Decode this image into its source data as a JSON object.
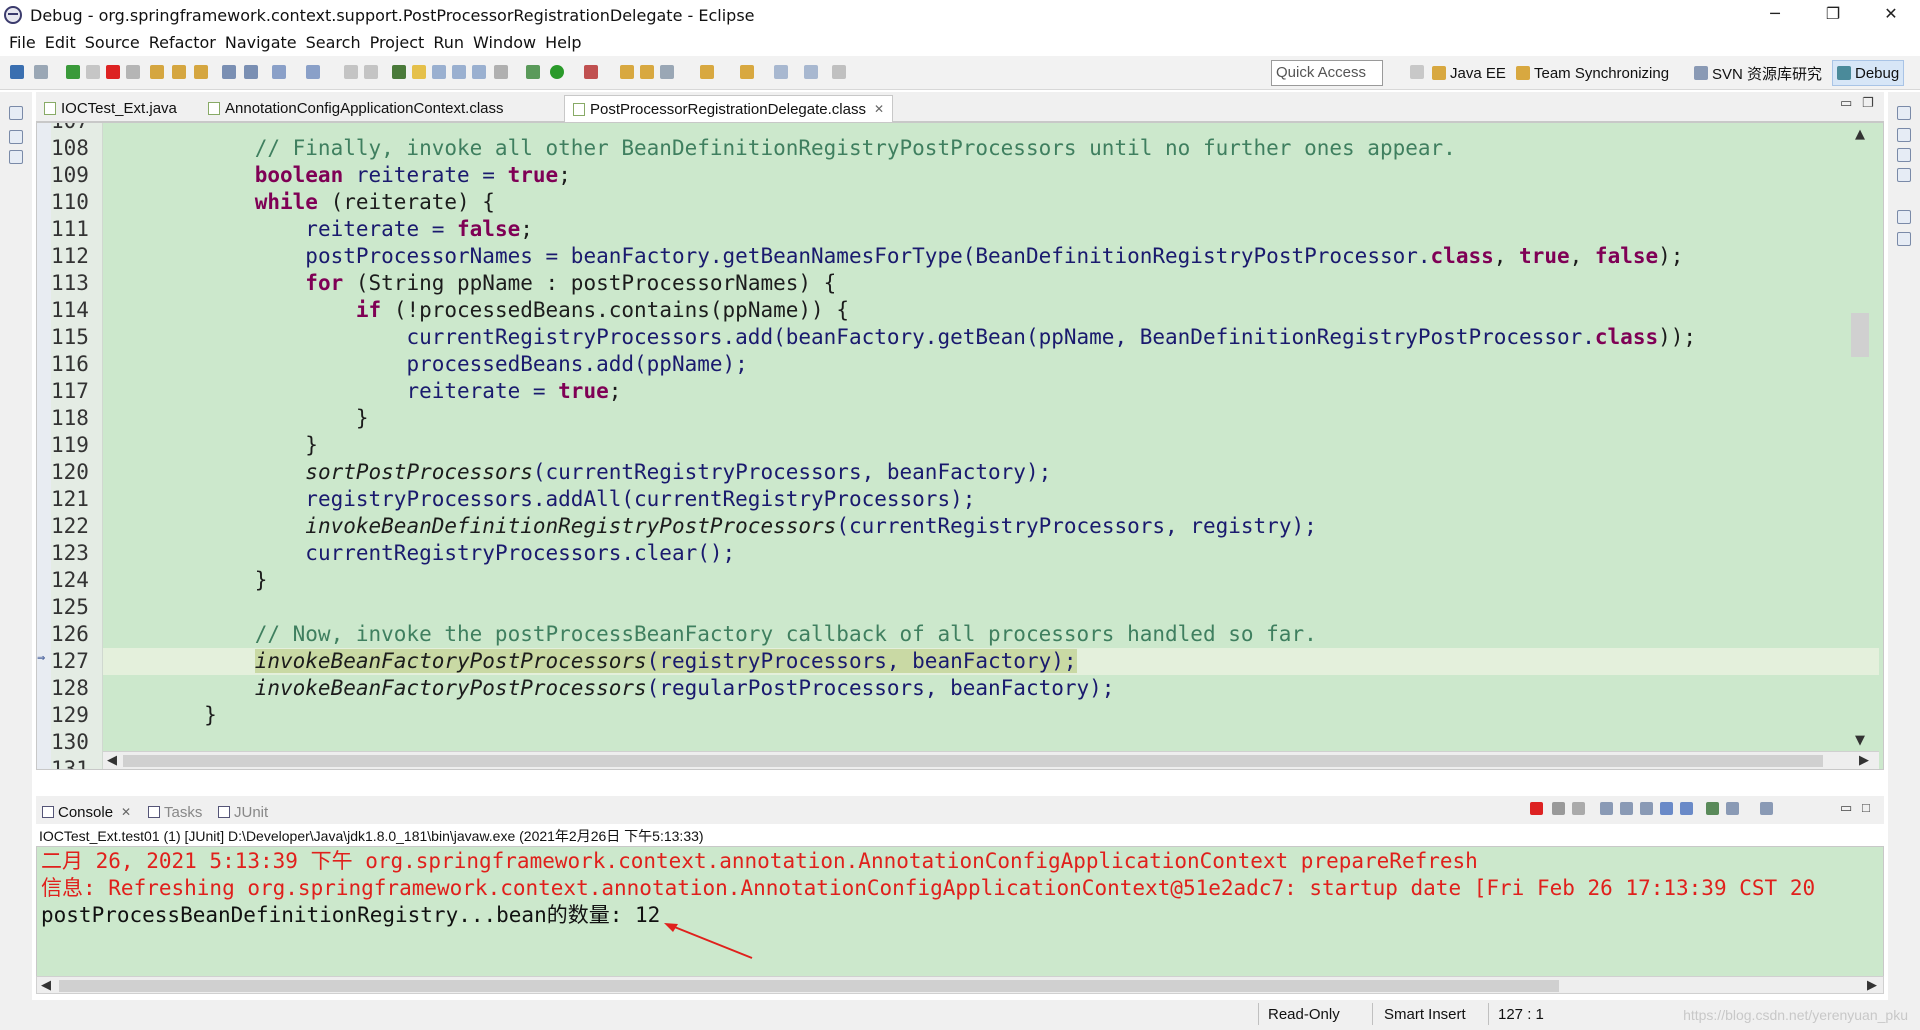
{
  "window": {
    "title": "Debug - org.springframework.context.support.PostProcessorRegistrationDelegate - Eclipse",
    "controls": [
      "─",
      "❐",
      "✕"
    ]
  },
  "menu": [
    "File",
    "Edit",
    "Source",
    "Refactor",
    "Navigate",
    "Search",
    "Project",
    "Run",
    "Window",
    "Help"
  ],
  "toolbar": {
    "quick_access_placeholder": "Quick Access",
    "perspectives": [
      "Java EE",
      "Team Synchronizing",
      "SVN 资源库研究",
      "Debug"
    ],
    "active_perspective": "Debug"
  },
  "editor": {
    "tabs": [
      {
        "label": "IOCTest_Ext.java",
        "active": false
      },
      {
        "label": "AnnotationConfigApplicationContext.class",
        "active": false
      },
      {
        "label": "PostProcessorRegistrationDelegate.class",
        "active": true
      }
    ],
    "partial_top_line": "107",
    "partial_bottom_line": "131",
    "line_numbers": [
      "108",
      "109",
      "110",
      "111",
      "112",
      "113",
      "114",
      "115",
      "116",
      "117",
      "118",
      "119",
      "120",
      "121",
      "122",
      "123",
      "124",
      "125",
      "126",
      "127",
      "128",
      "129",
      "130"
    ],
    "current_line": "127",
    "code": {
      "l108": "// Finally, invoke all other BeanDefinitionRegistryPostProcessors until no further ones appear.",
      "l109a": "boolean",
      "l109b": " reiterate = ",
      "l109c": "true",
      "l109d": ";",
      "l110a": "while",
      "l110b": " (reiterate) {",
      "l111a": "reiterate = ",
      "l111b": "false",
      "l111c": ";",
      "l112a": "postProcessorNames = beanFactory.getBeanNamesForType(BeanDefinitionRegistryPostProcessor.",
      "l112b": "class",
      "l112c": ", ",
      "l112d": "true",
      "l112e": ", ",
      "l112f": "false",
      "l112g": ");",
      "l113a": "for",
      "l113b": " (String ppName : postProcessorNames) {",
      "l114a": "if",
      "l114b": " (!processedBeans.contains(ppName)) {",
      "l115a": "currentRegistryProcessors.add(beanFactory.getBean(ppName, BeanDefinitionRegistryPostProcessor.",
      "l115b": "class",
      "l115c": "));",
      "l116": "processedBeans.add(ppName);",
      "l117a": "reiterate = ",
      "l117b": "true",
      "l117c": ";",
      "l118": "}",
      "l119": "}",
      "l120a": "sortPostProcessors",
      "l120b": "(currentRegistryProcessors, beanFactory);",
      "l121": "registryProcessors.addAll(currentRegistryProcessors);",
      "l122a": "invokeBeanDefinitionRegistryPostProcessors",
      "l122b": "(currentRegistryProcessors, registry);",
      "l123": "currentRegistryProcessors.clear();",
      "l124": "}",
      "l126": "// Now, invoke the postProcessBeanFactory callback of all processors handled so far.",
      "l127a": "invokeBeanFactoryPostProcessors",
      "l127b": "(registryProcessors, beanFactory);",
      "l128a": "invokeBeanFactoryPostProcessors",
      "l128b": "(regularPostProcessors, beanFactory);",
      "l129": "}"
    }
  },
  "console": {
    "tabs": [
      "Console",
      "Tasks",
      "JUnit"
    ],
    "launch": "IOCTest_Ext.test01 (1) [JUnit] D:\\Developer\\Java\\jdk1.8.0_181\\bin\\javaw.exe (2021年2月26日 下午5:13:33)",
    "lines": [
      "二月 26, 2021 5:13:39 下午 org.springframework.context.annotation.AnnotationConfigApplicationContext prepareRefresh",
      "信息: Refreshing org.springframework.context.annotation.AnnotationConfigApplicationContext@51e2adc7: startup date [Fri Feb 26 17:13:39 CST 20",
      "postProcessBeanDefinitionRegistry...bean的数量: 12"
    ]
  },
  "status": {
    "read_only": "Read-Only",
    "insert_mode": "Smart Insert",
    "position": "127 : 1",
    "watermark": "https://blog.csdn.net/yerenyuan_pku"
  },
  "colors": {
    "editor_bg": "#cce8cc",
    "keyword": "#7f0055",
    "comment": "#3f7f5f",
    "console_error": "#e0201c",
    "annotation_arrow": "#e0201c"
  }
}
